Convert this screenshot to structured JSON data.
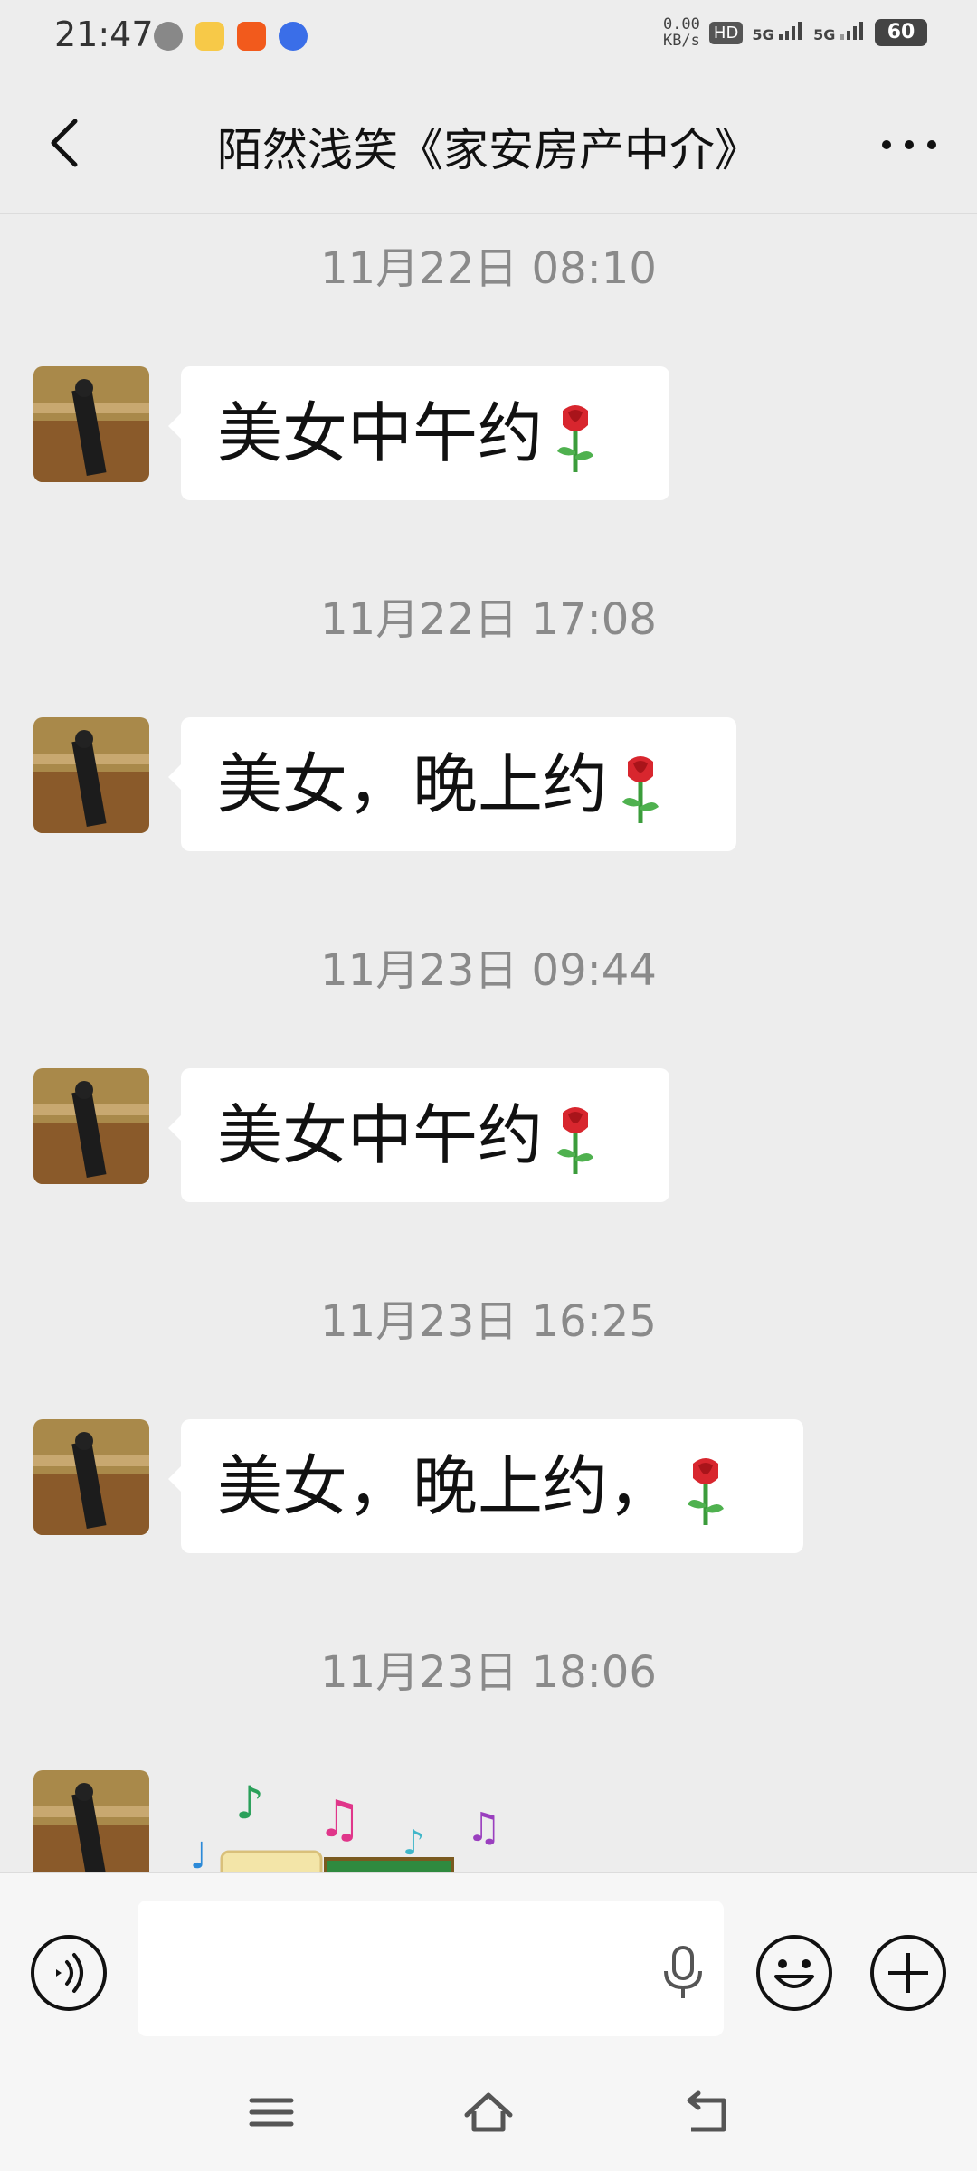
{
  "status_bar": {
    "time": "21:47",
    "net_speed_value": "0.00",
    "net_speed_unit": "KB/s",
    "hd_badge": "HD",
    "signal1": "5G",
    "signal2": "5G",
    "battery": "60"
  },
  "header": {
    "title": "陌然浅笑《家安房产中介》"
  },
  "messages": [
    {
      "time": "11月22日 08:10",
      "text": "美女中午约"
    },
    {
      "time": "11月22日 17:08",
      "text": "美女，晚上约"
    },
    {
      "time": "11月23日 09:44",
      "text": "美女中午约"
    },
    {
      "time": "11月23日 16:25",
      "text": "美女，晚上约，"
    },
    {
      "time": "11月23日 18:06",
      "text": ""
    }
  ],
  "icons": {
    "back": "back-arrow-icon",
    "more": "more-icon",
    "voice": "voice-icon",
    "mic": "mic-icon",
    "emoji": "emoji-icon",
    "add": "add-icon",
    "rose": "rose-icon",
    "menu": "menu-icon",
    "home": "home-icon",
    "return": "return-icon"
  },
  "colors": {
    "background": "#ededed",
    "bubble": "#ffffff",
    "timestamp": "#8a8a8a"
  }
}
